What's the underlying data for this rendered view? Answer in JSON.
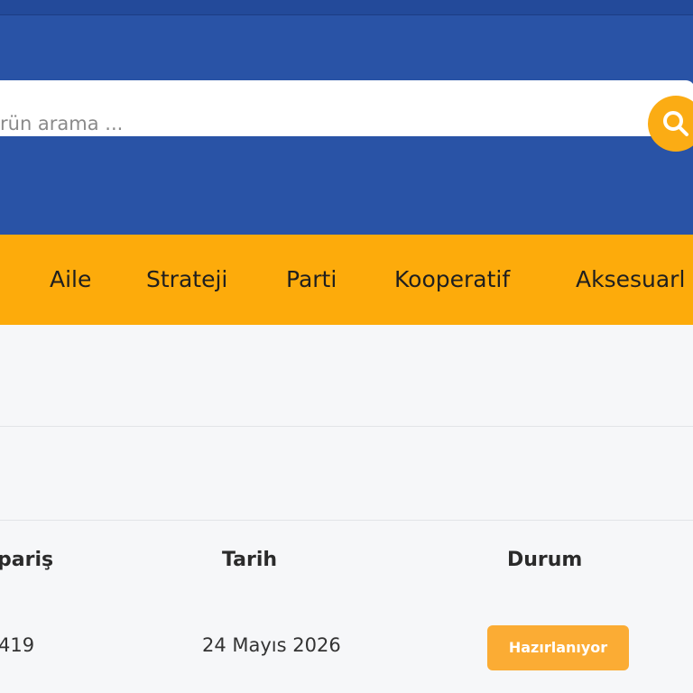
{
  "search": {
    "placeholder": "rün arama ..."
  },
  "nav": {
    "items": [
      {
        "label": "Aile"
      },
      {
        "label": "Strateji"
      },
      {
        "label": "Parti"
      },
      {
        "label": "Kooperatif"
      },
      {
        "label": "Aksesuarl"
      }
    ]
  },
  "orders": {
    "headers": {
      "order": "pariş",
      "date": "Tarih",
      "status": "Durum"
    },
    "rows": [
      {
        "order": "419",
        "date": "24 Mayıs 2026",
        "status": "Hazırlanıyor"
      }
    ]
  },
  "colors": {
    "header_blue": "#2953a6",
    "nav_orange": "#fdab0b",
    "accent": "#fbac14",
    "badge": "#fbac34"
  },
  "icons": {
    "search_button": "search-icon"
  }
}
